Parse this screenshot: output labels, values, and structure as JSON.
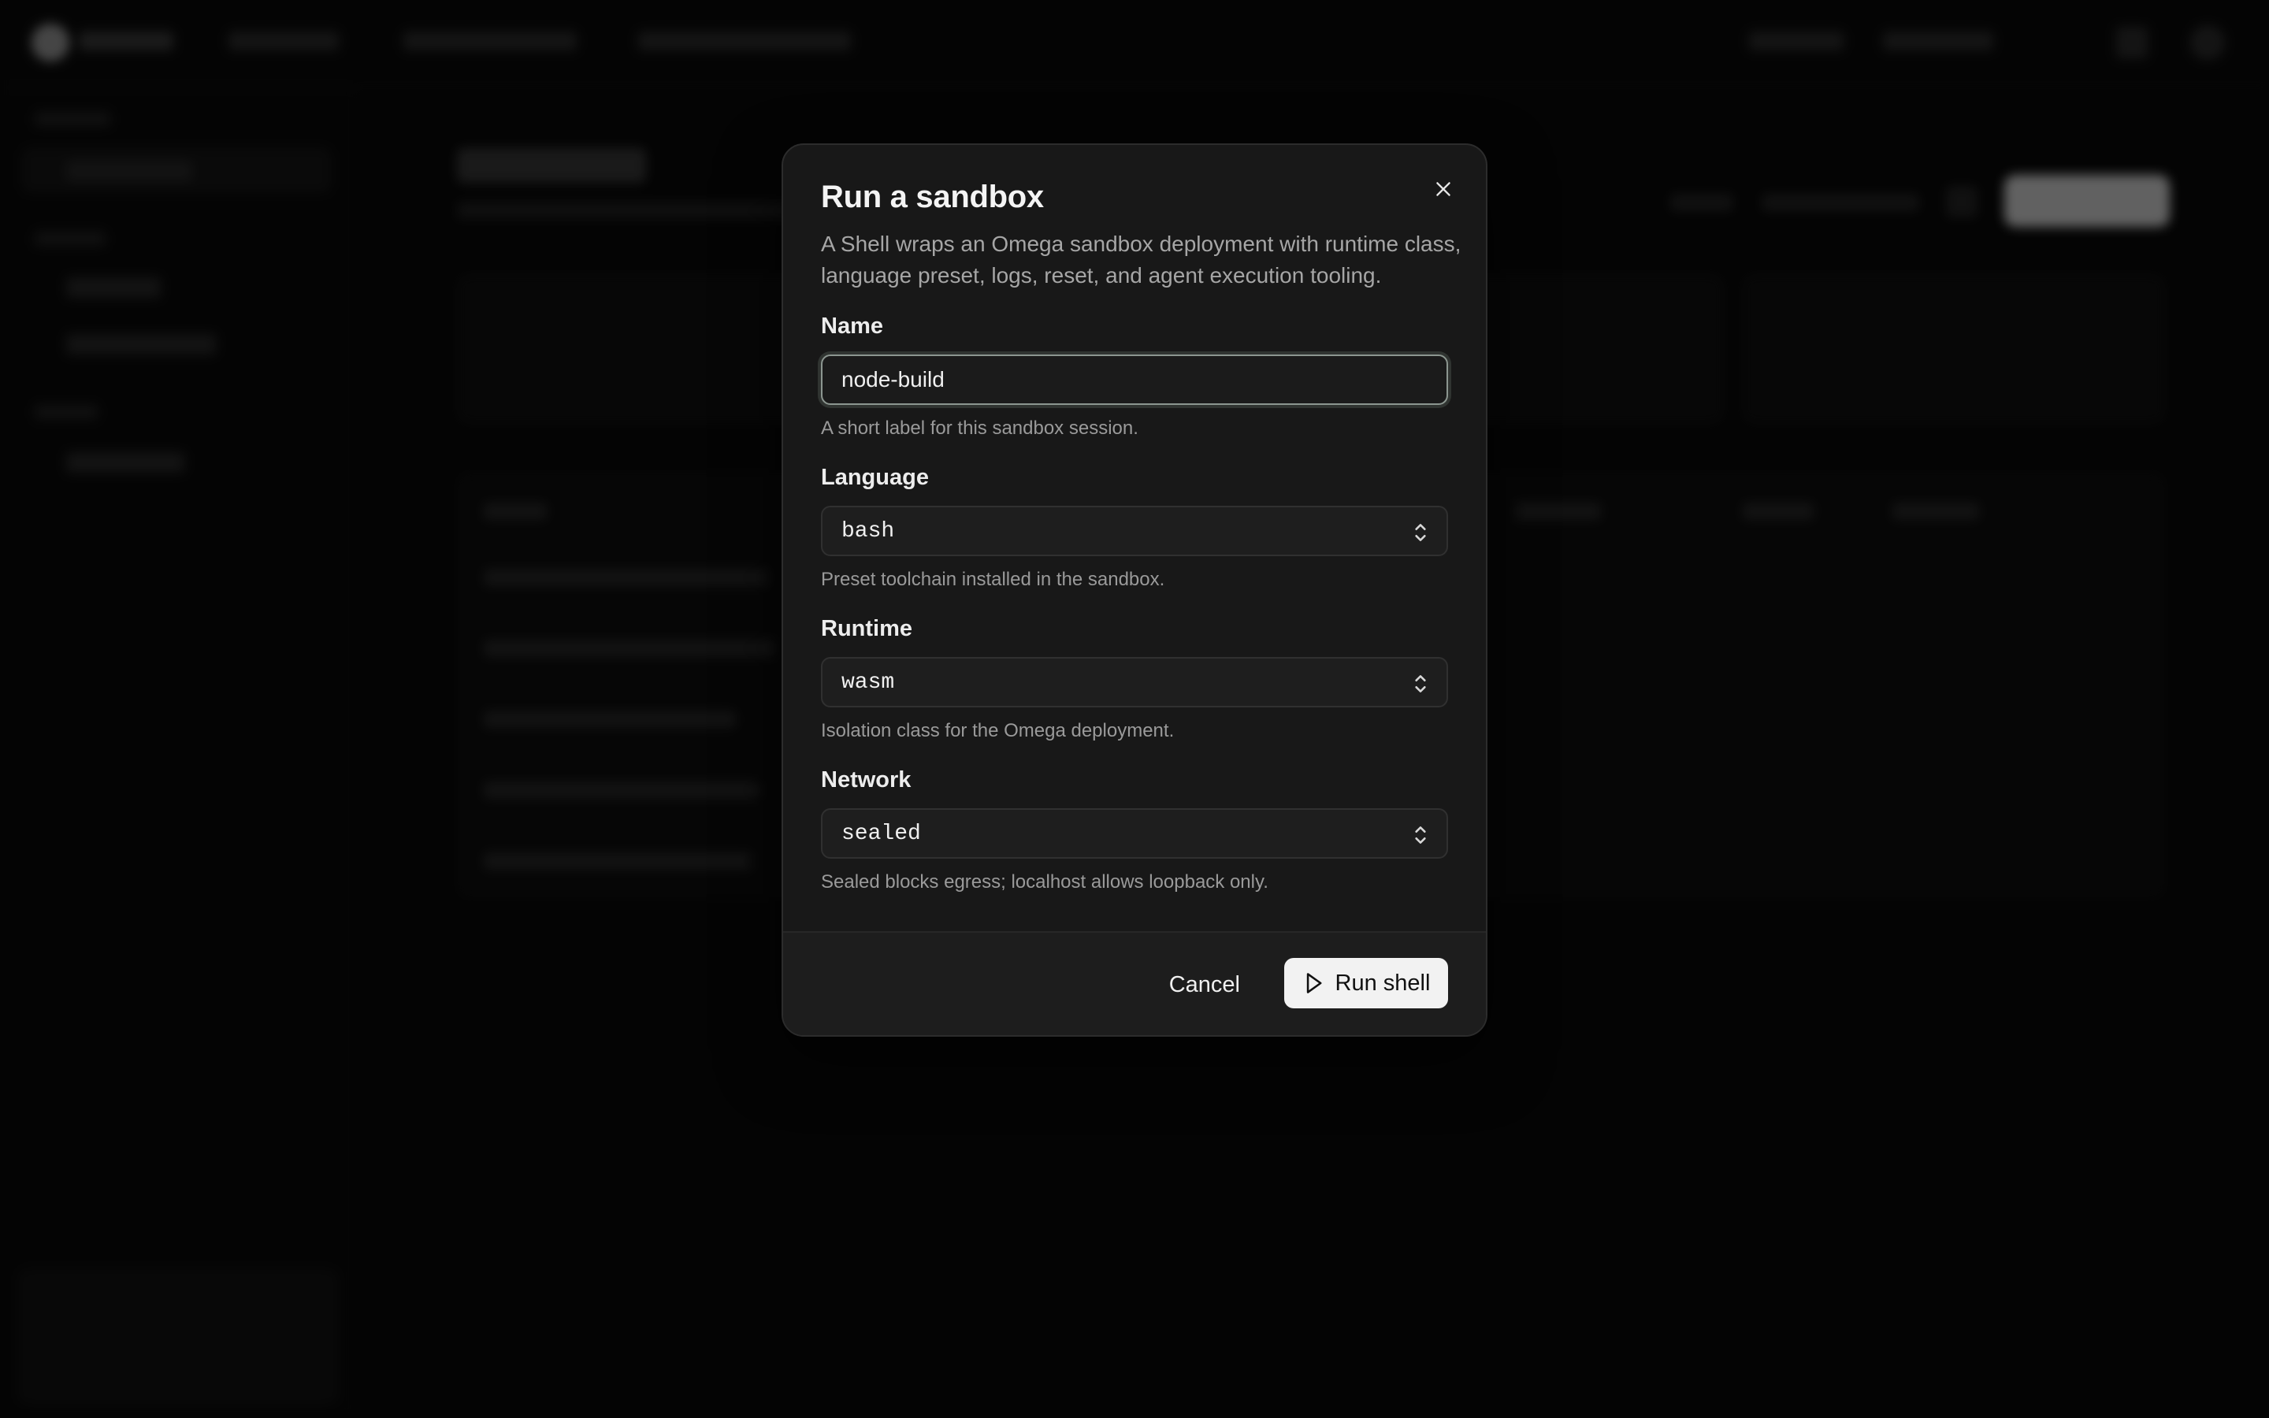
{
  "dialog": {
    "title": "Run a sandbox",
    "description": "A Shell wraps an Omega sandbox deployment with runtime class, language preset, logs, reset, and agent execution tooling.",
    "close_icon": "close-icon",
    "fields": {
      "name": {
        "label": "Name",
        "value": "node-build",
        "hint": "A short label for this sandbox session."
      },
      "language": {
        "label": "Language",
        "value": "bash",
        "hint": "Preset toolchain installed in the sandbox."
      },
      "runtime": {
        "label": "Runtime",
        "value": "wasm",
        "hint": "Isolation class for the Omega deployment."
      },
      "network": {
        "label": "Network",
        "value": "sealed",
        "hint": "Sealed blocks egress; localhost allows loopback only."
      }
    },
    "footer": {
      "cancel_label": "Cancel",
      "run_label": "Run shell",
      "run_icon": "play-icon"
    }
  },
  "colors": {
    "dialog_bg": "#181818",
    "focus_ring": "#8c9690",
    "primary_button": "#f2f2f2"
  }
}
